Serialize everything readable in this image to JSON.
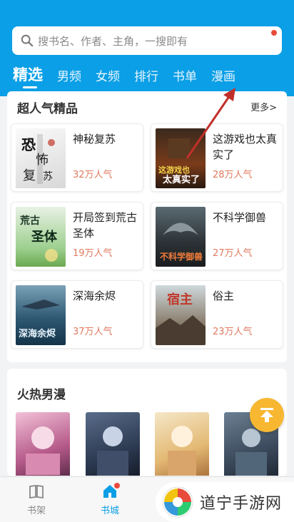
{
  "search": {
    "placeholder": "搜书名、作者、主角，一搜即有"
  },
  "tabs": [
    {
      "label": "精选",
      "active": true
    },
    {
      "label": "男频"
    },
    {
      "label": "女频"
    },
    {
      "label": "排行"
    },
    {
      "label": "书单"
    },
    {
      "label": "漫画"
    }
  ],
  "section1": {
    "title": "超人气精品",
    "more": "更多>",
    "books": [
      {
        "name": "神秘复苏",
        "popularity": "32万人气",
        "cover_text": "恐怖复苏"
      },
      {
        "name": "这游戏也太真实了",
        "popularity": "28万人气",
        "cover_text": "这游戏也太真实了"
      },
      {
        "name": "开局签到荒古圣体",
        "popularity": "19万人气",
        "cover_text": "荒古圣体"
      },
      {
        "name": "不科学御兽",
        "popularity": "27万人气",
        "cover_text": "不科学御兽"
      },
      {
        "name": "深海余烬",
        "popularity": "37万人气",
        "cover_text": "深海余烬"
      },
      {
        "name": "俗主",
        "popularity": "23万人气",
        "cover_text": "宿主"
      }
    ]
  },
  "section2": {
    "title": "火热男漫"
  },
  "bottom_nav": [
    {
      "label": "书架",
      "icon": "book-icon"
    },
    {
      "label": "书城",
      "icon": "home-icon",
      "active": true
    }
  ],
  "watermark": {
    "text": "道宁手游网"
  },
  "colors": {
    "accent": "#0a9fe6",
    "popularity": "#e07a5f",
    "fab": "#f7b731",
    "badge": "#e84b3c"
  }
}
